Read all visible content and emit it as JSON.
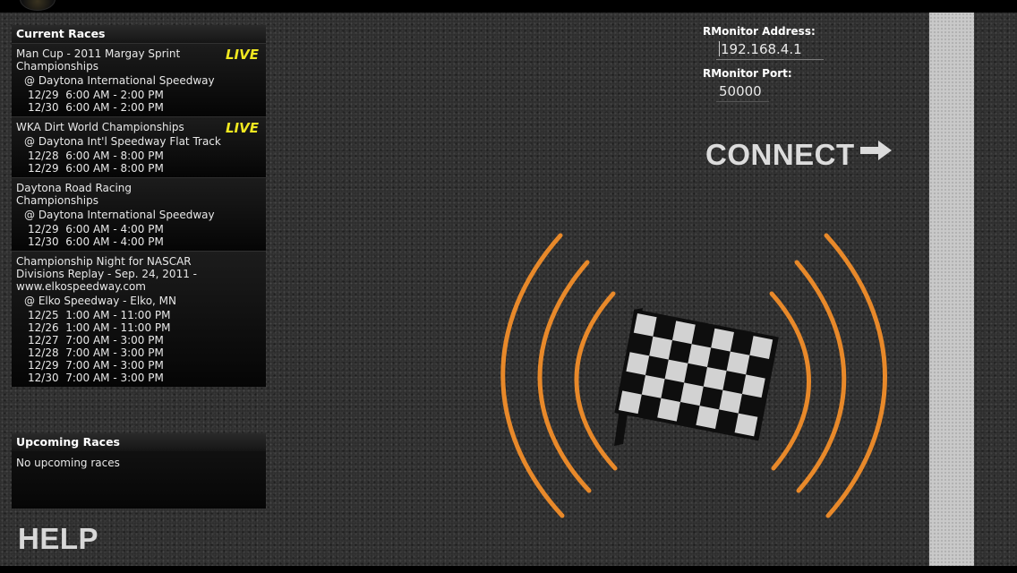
{
  "current_races": {
    "header": "Current Races",
    "races": [
      {
        "title": "Man Cup - 2011 Margay Sprint Championships",
        "live": "LIVE",
        "venue": "@ Daytona International Speedway",
        "times": [
          "12/29  6:00 AM - 2:00 PM",
          "12/30  6:00 AM - 2:00 PM"
        ]
      },
      {
        "title": "WKA Dirt World Championships",
        "live": "LIVE",
        "venue": "@ Daytona Int'l Speedway Flat Track",
        "times": [
          "12/28  6:00 AM - 8:00 PM",
          "12/29  6:00 AM - 8:00 PM"
        ]
      },
      {
        "title": "Daytona Road Racing Championships",
        "live": "",
        "venue": "@ Daytona International Speedway",
        "times": [
          "12/29  6:00 AM - 4:00 PM",
          "12/30  6:00 AM - 4:00 PM"
        ]
      },
      {
        "title": "Championship Night for NASCAR Divisions Replay - Sep. 24, 2011 - www.elkospeedway.com",
        "live": "",
        "venue": "@ Elko Speedway - Elko, MN",
        "times": [
          "12/25  1:00 AM - 11:00 PM",
          "12/26  1:00 AM - 11:00 PM",
          "12/27  7:00 AM - 3:00 PM",
          "12/28  7:00 AM - 3:00 PM",
          "12/29  7:00 AM - 3:00 PM",
          "12/30  7:00 AM - 3:00 PM"
        ]
      }
    ]
  },
  "upcoming_races": {
    "header": "Upcoming Races",
    "empty_text": "No upcoming races"
  },
  "help_label": "HELP",
  "connection": {
    "address_label": "RMonitor Address:",
    "address_value": "192.168.4.1",
    "port_label": "RMonitor Port:",
    "port_value": "50000",
    "connect_label": "CONNECT",
    "connect_icon": "arrow-right-icon"
  },
  "graphic": {
    "icon": "checkered-flag-signal-icon",
    "arc_color": "#e8892a"
  }
}
